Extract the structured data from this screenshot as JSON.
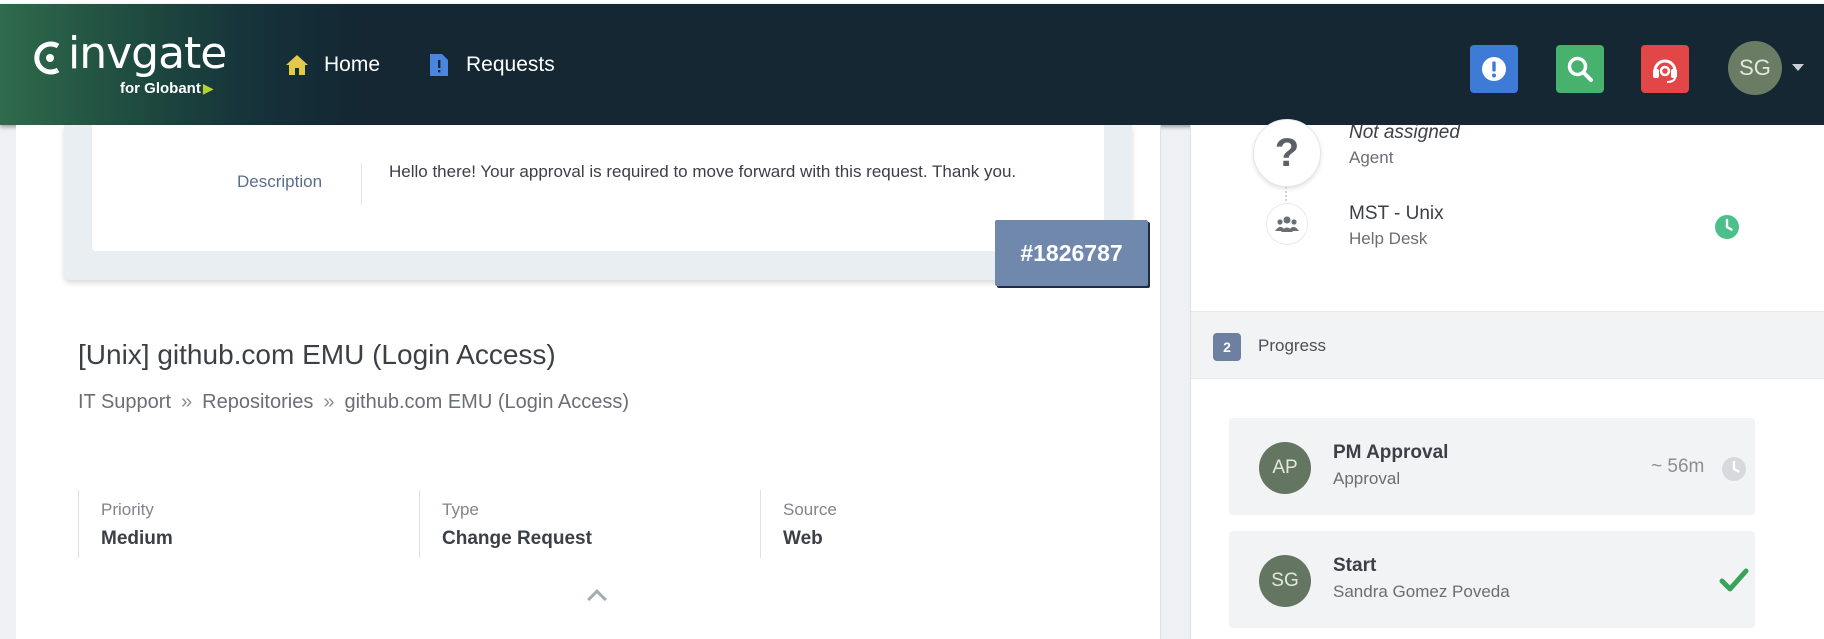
{
  "app": {
    "logo_word": "invgate",
    "logo_sub": "for Globant"
  },
  "nav": {
    "home": "Home",
    "requests": "Requests"
  },
  "user": {
    "initials": "SG"
  },
  "description": {
    "label": "Description",
    "text": "Hello there! Your approval is required to move forward with this request. Thank you."
  },
  "request": {
    "title": "[Unix] github.com EMU (Login Access)",
    "breadcrumb": [
      "IT Support",
      "Repositories",
      "github.com EMU (Login Access)"
    ],
    "id": "#1826787",
    "fields": [
      {
        "label": "Priority",
        "value": "Medium"
      },
      {
        "label": "Type",
        "value": "Change Request"
      },
      {
        "label": "Source",
        "value": "Web"
      }
    ]
  },
  "assignment": {
    "agent_name": "Not assigned",
    "agent_role": "Agent",
    "group_name": "MST - Unix",
    "group_role": "Help Desk"
  },
  "progress": {
    "number": "2",
    "label": "Progress",
    "steps": [
      {
        "initials": "AP",
        "name": "PM Approval",
        "sub": "Approval",
        "time": "~ 56m",
        "status": "pending"
      },
      {
        "initials": "SG",
        "name": "Start",
        "sub": "Sandra Gomez Poveda",
        "status": "done"
      }
    ]
  },
  "colors": {
    "topbar": "#142733",
    "alert_button": "#3e7bd6",
    "search_button": "#47b26d",
    "support_button": "#e24646",
    "request_id_badge": "#7188ad",
    "check": "#3aa35a",
    "teal_clock": "#4cc08a"
  }
}
